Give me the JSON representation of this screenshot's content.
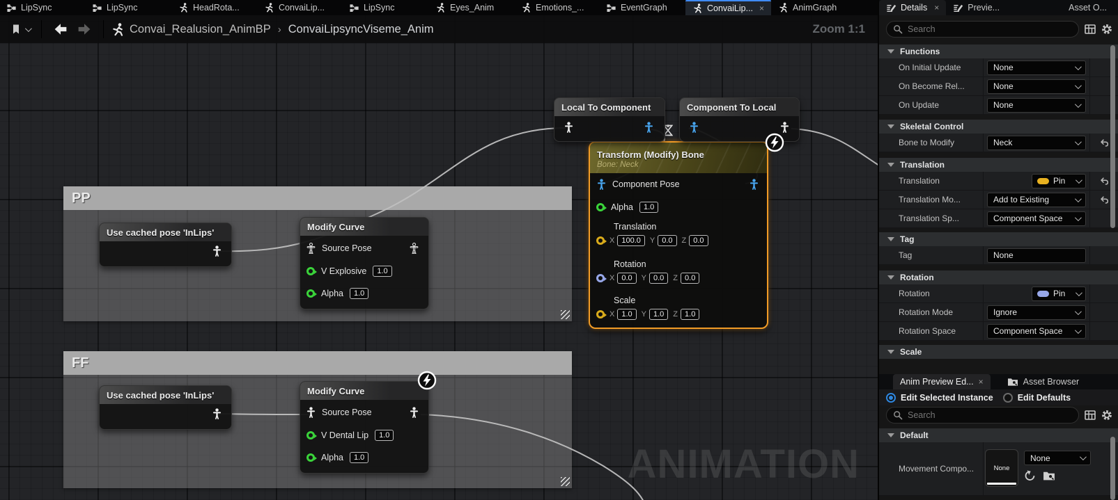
{
  "window": {
    "zoom_label": "Zoom 1:1",
    "watermark": "ANIMATION"
  },
  "tab_bar": {
    "tabs": [
      {
        "label": "LipSync",
        "icon": "graph-icon",
        "active": false
      },
      {
        "label": "LipSync",
        "icon": "graph-icon",
        "active": false
      },
      {
        "label": "HeadRota...",
        "icon": "runner-icon",
        "active": false
      },
      {
        "label": "ConvaiLip...",
        "icon": "runner-icon",
        "active": false
      },
      {
        "label": "LipSync",
        "icon": "graph-icon",
        "active": false
      },
      {
        "label": "Eyes_Anim",
        "icon": "runner-icon",
        "active": false
      },
      {
        "label": "Emotions_...",
        "icon": "runner-icon",
        "active": false
      },
      {
        "label": "EventGraph",
        "icon": "graph-icon",
        "active": false
      },
      {
        "label": "ConvaiLip...",
        "icon": "runner-icon",
        "active": true,
        "close_label": "×"
      },
      {
        "label": "AnimGraph",
        "icon": "runner-icon",
        "active": false
      }
    ]
  },
  "toolbar": {
    "breadcrumb_root": "Convai_Realusion_AnimBP",
    "breadcrumb_separator": "›",
    "breadcrumb_current": "ConvaiLipsyncViseme_Anim"
  },
  "graph": {
    "axis": {
      "x": "X",
      "y": "Y",
      "z": "Z"
    },
    "comment_pp": {
      "title": "PP"
    },
    "comment_ff": {
      "title": "FF"
    },
    "local_to_component": {
      "title": "Local To Component"
    },
    "component_to_local": {
      "title": "Component To Local"
    },
    "transform_bone": {
      "title": "Transform (Modify) Bone",
      "subtitle": "Bone: Neck",
      "component_pose_label": "Component Pose",
      "alpha_label": "Alpha",
      "alpha_value": "1.0",
      "translation_label": "Translation",
      "translation": {
        "x": "100.0",
        "y": "0.0",
        "z": "0.0"
      },
      "rotation_label": "Rotation",
      "rotation": {
        "x": "0.0",
        "y": "0.0",
        "z": "0.0"
      },
      "scale_label": "Scale",
      "scale": {
        "x": "1.0",
        "y": "1.0",
        "z": "1.0"
      }
    },
    "pp_cached_pose": {
      "title": "Use cached pose 'InLips'"
    },
    "pp_modify_curve": {
      "title": "Modify Curve",
      "source_pose_label": "Source Pose",
      "curve_label": "V Explosive",
      "curve_value": "1.0",
      "alpha_label": "Alpha",
      "alpha_value": "1.0"
    },
    "ff_cached_pose": {
      "title": "Use cached pose 'InLips'"
    },
    "ff_modify_curve": {
      "title": "Modify Curve",
      "source_pose_label": "Source Pose",
      "curve_label": "V Dental Lip",
      "curve_value": "1.0",
      "alpha_label": "Alpha",
      "alpha_value": "1.0"
    }
  },
  "details": {
    "tabs": [
      {
        "label": "Details",
        "close_label": "×",
        "active": true
      },
      {
        "label": "Previe...",
        "active": false
      },
      {
        "label": "Asset O...",
        "active": false
      }
    ],
    "search_placeholder": "Search",
    "functions": {
      "title": "Functions",
      "rows": [
        {
          "label": "On Initial Update",
          "value": "None"
        },
        {
          "label": "On Become Rel...",
          "value": "None"
        },
        {
          "label": "On Update",
          "value": "None"
        }
      ]
    },
    "skeletal_control": {
      "title": "Skeletal Control",
      "rows": [
        {
          "label": "Bone to Modify",
          "value": "Neck"
        }
      ]
    },
    "translation": {
      "title": "Translation",
      "rows": [
        {
          "label": "Translation",
          "value": "Pin"
        },
        {
          "label": "Translation Mo...",
          "value": "Add to Existing"
        },
        {
          "label": "Translation Sp...",
          "value": "Component Space"
        }
      ]
    },
    "tag": {
      "title": "Tag",
      "rows": [
        {
          "label": "Tag",
          "value": "None"
        }
      ]
    },
    "rotation": {
      "title": "Rotation",
      "rows": [
        {
          "label": "Rotation",
          "value": "Pin"
        },
        {
          "label": "Rotation Mode",
          "value": "Ignore"
        },
        {
          "label": "Rotation Space",
          "value": "Component Space"
        }
      ]
    },
    "scale": {
      "title": "Scale"
    },
    "preview": {
      "tab_anim_preview": "Anim Preview Ed...",
      "tab_anim_preview_close": "×",
      "tab_asset_browser": "Asset Browser",
      "radio_selected_instance": "Edit Selected Instance",
      "radio_edit_defaults": "Edit Defaults",
      "search_placeholder": "Search",
      "default_section_title": "Default",
      "movement_label": "Movement Compo...",
      "movement_thumb_label": "None",
      "movement_value": "None"
    }
  },
  "colors": {
    "selection_orange": "#f19b26",
    "pin_green": "#3ad33a",
    "pin_yellow": "#d9ab1b",
    "pin_lavender": "#97a7e8",
    "pose_pin_blue": "#49a7f2",
    "active_tab_accent": "#3f8cff",
    "comment_gray": "#a9a9a9"
  }
}
